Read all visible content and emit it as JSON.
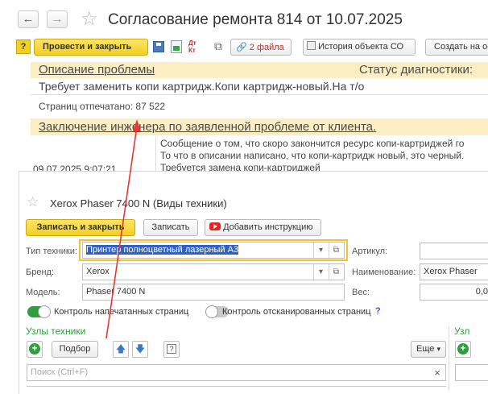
{
  "back_window": {
    "title": "Согласование ремонта 814 от 10.07.2025",
    "nav": {
      "back": "←",
      "forward": "→"
    },
    "toolbar": {
      "post_close": "Провести и закрыть",
      "files": "2 файла",
      "history": "История объекта СО",
      "create_basis": "Создать на осно"
    },
    "problem": {
      "title": "Описание проблемы",
      "status_label": "Статус диагностики:",
      "text": "Требует заменить копи картридж.Копи картридж-новый.На т/о",
      "pages_label": "Страниц отпечатано: 87 522"
    },
    "conclusion": {
      "title": "Заключение инженера по заявленной проблеме от клиента.",
      "timestamp": "09.07.2025 9:07:21",
      "lines": [
        "Сообщение о том, что скоро закончится ресурс копи-картриджей го",
        "То что в описании написано, что копи-картридж новый, это черный.",
        "Требуется замена копи-картриджей"
      ]
    }
  },
  "front_window": {
    "title": "Xerox Phaser 7400 N (Виды техники)",
    "buttons": {
      "save_close": "Записать и закрыть",
      "save": "Записать",
      "add_instruction": "Добавить инструкцию"
    },
    "fields": {
      "type_label": "Тип техники:",
      "type_value": "Принтер полноцветный лазерный А3",
      "brand_label": "Бренд:",
      "brand_value": "Xerox",
      "model_label": "Модель:",
      "model_value": "Phaser 7400 N",
      "article_label": "Артикул:",
      "article_value": "",
      "name_label": "Наименование:",
      "name_value": "Xerox Phaser",
      "weight_label": "Вес:",
      "weight_value": "0,0"
    },
    "toggles": {
      "printed_label": "Контроль напечатанных страниц",
      "printed_on": true,
      "scanned_label": "Контроль отсканированных страниц",
      "scanned_on": false,
      "help": "?"
    },
    "nodes": {
      "title": "Узлы техники",
      "select": "Подбор",
      "more": "Еще",
      "search_placeholder": "Поиск (Ctrl+F)",
      "right_title": "Узл"
    }
  },
  "colors": {
    "accent_green": "#2e9e3e",
    "yellow_button": "#f3cf1f",
    "arrow": "#e53935",
    "title_band": "#fbeec2"
  }
}
